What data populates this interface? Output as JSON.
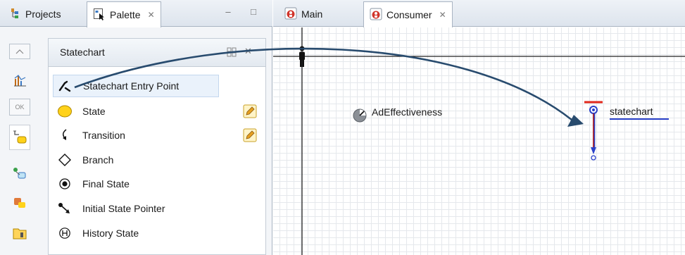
{
  "left_tabs": {
    "projects_label": "Projects",
    "palette_label": "Palette",
    "palette_close": "✕",
    "minimize_symbol": "–",
    "maximize_symbol": "□"
  },
  "editor_tabs": {
    "main_label": "Main",
    "consumer_label": "Consumer",
    "consumer_close": "✕"
  },
  "palette": {
    "title": "Statechart",
    "close_symbol": "✕",
    "items": [
      {
        "label": "Statechart Entry Point",
        "icon": "statechart-entry-point-icon"
      },
      {
        "label": "State",
        "icon": "state-icon"
      },
      {
        "label": "Transition",
        "icon": "transition-icon"
      },
      {
        "label": "Branch",
        "icon": "branch-icon"
      },
      {
        "label": "Final State",
        "icon": "final-state-icon"
      },
      {
        "label": "Initial State Pointer",
        "icon": "initial-state-pointer-icon"
      },
      {
        "label": "History State",
        "icon": "history-state-icon"
      }
    ],
    "tool_strip": [
      "scroll-up-icon",
      "analysis-icon",
      "controls-icon",
      "statechart-tool-icon",
      "connectivity-icon",
      "agent-icon",
      "presentation-icon"
    ]
  },
  "canvas": {
    "event_label": "AdEffectiveness",
    "statechart_label": "statechart"
  },
  "colors": {
    "arrow": "#284b6e",
    "state_yellow": "#ffd21a",
    "statechart_blue": "#2a41c9",
    "statechart_red": "#e0281c"
  }
}
